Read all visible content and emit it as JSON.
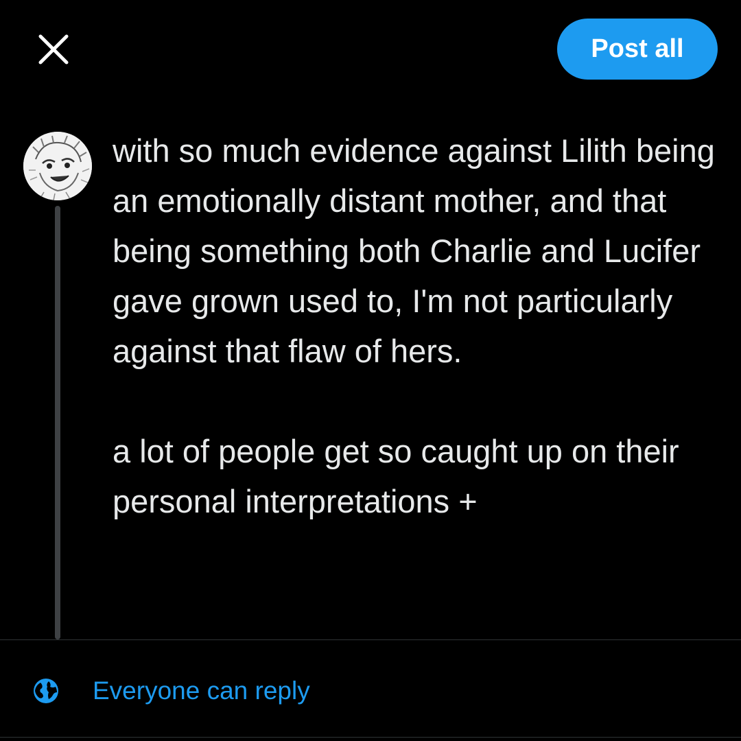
{
  "header": {
    "close_icon": "close-icon",
    "post_all_label": "Post all"
  },
  "composer": {
    "avatar_icon": "user-avatar",
    "paragraph_1": "with so much evidence against Lilith being an emotionally distant mother, and that being something both Charlie and Lucifer gave grown used to, I'm not particularly against that flaw of hers.",
    "paragraph_2": "a lot of people get so caught up on their personal interpretations +"
  },
  "footer": {
    "reply_icon": "globe-icon",
    "reply_setting_label": "Everyone can reply"
  },
  "colors": {
    "background": "#000000",
    "accent": "#1d9bf0",
    "text": "#e7e9ea",
    "thread_line": "#3e4144",
    "divider": "#2f3336"
  }
}
